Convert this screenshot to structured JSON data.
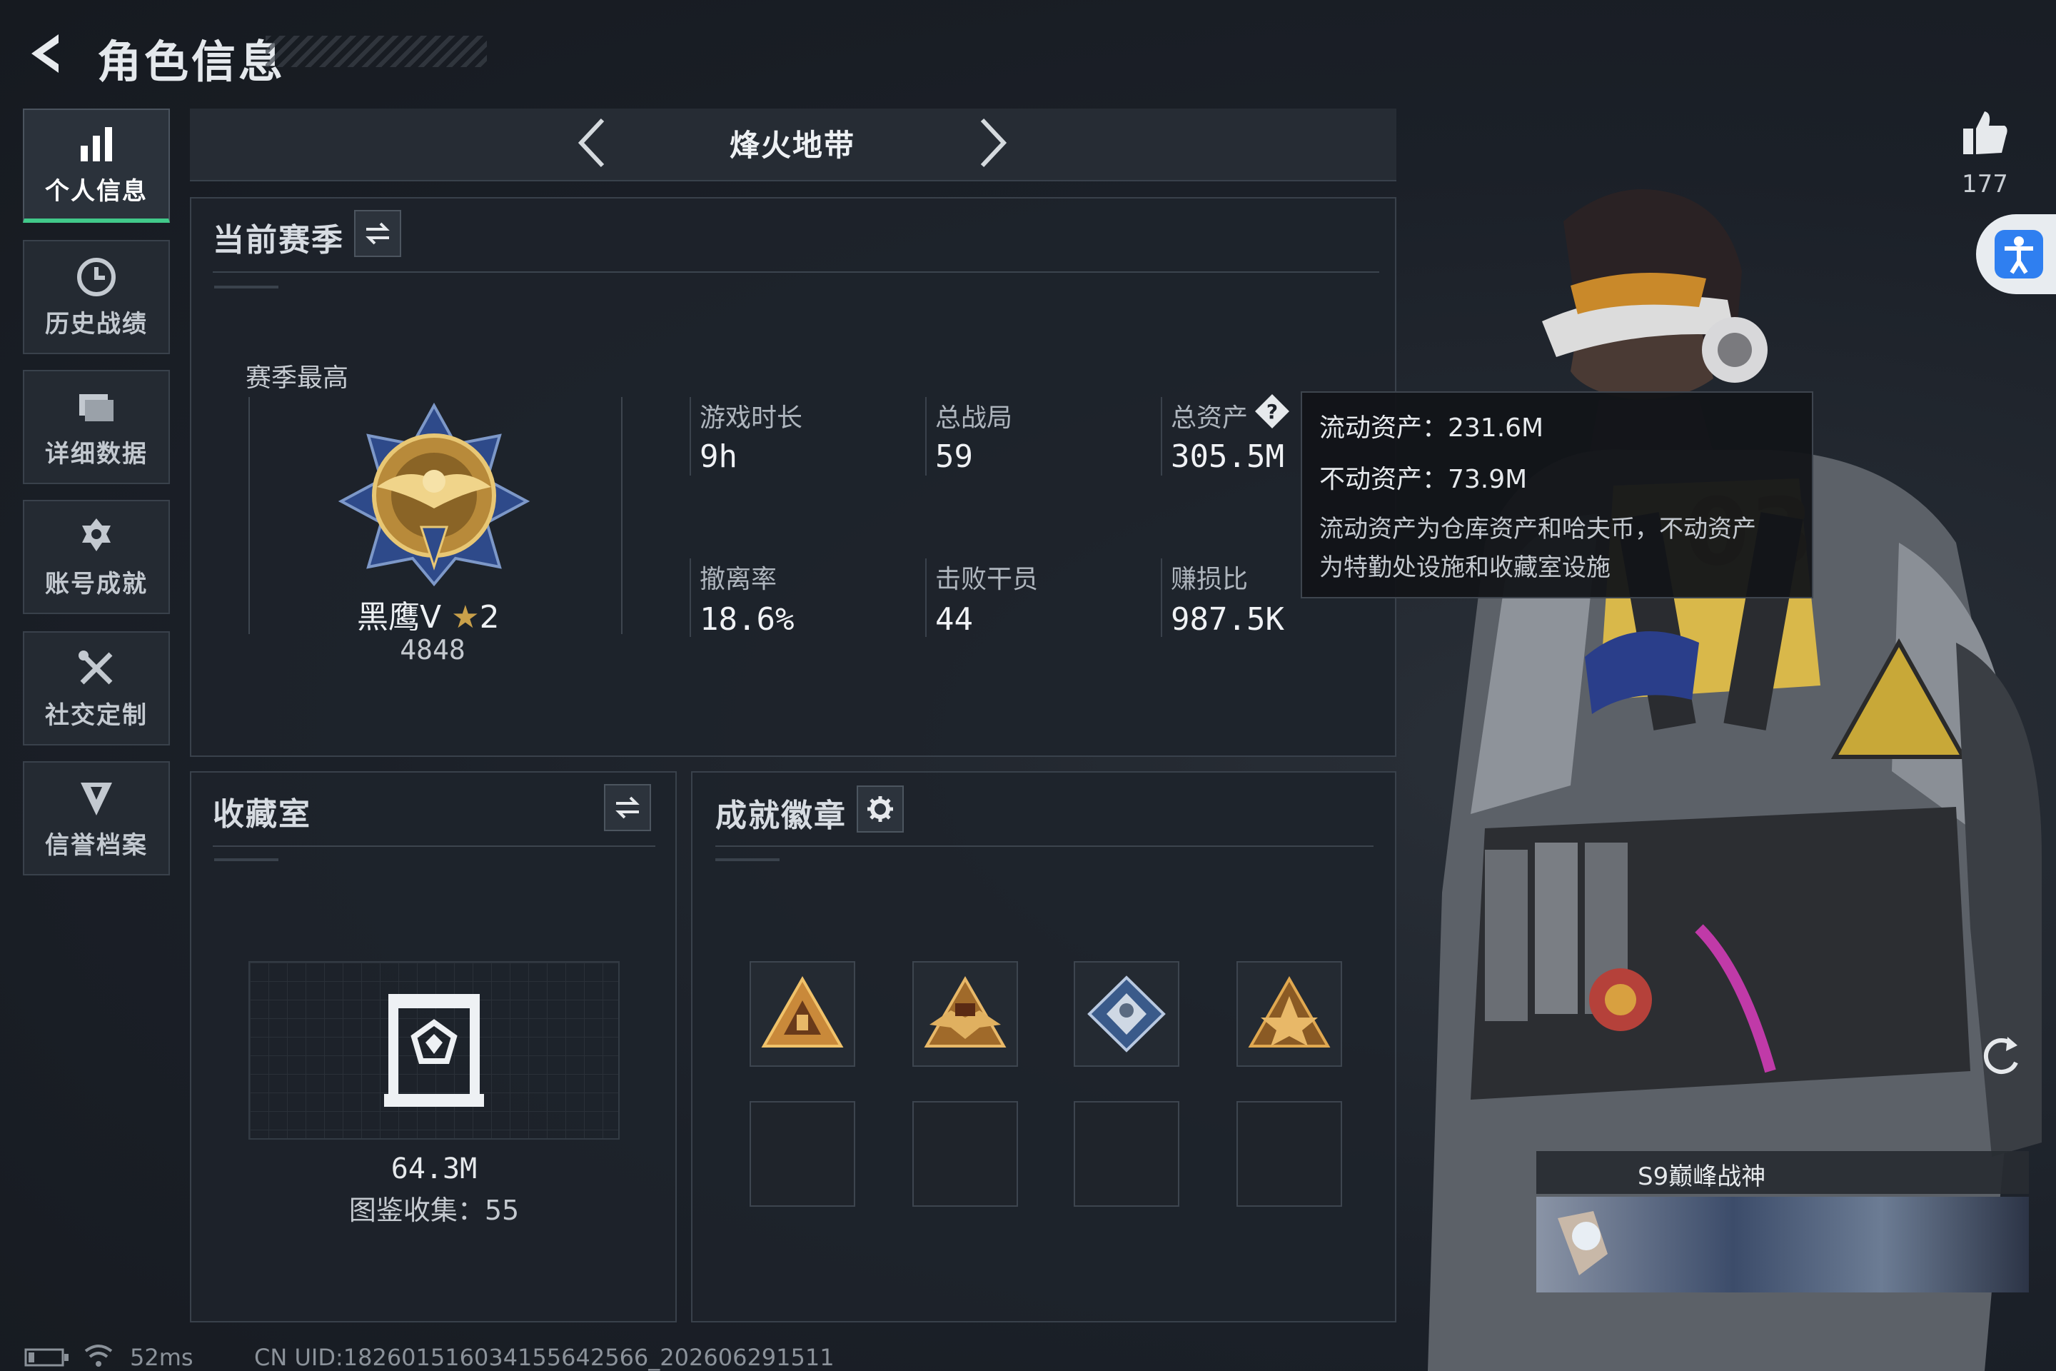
{
  "header": {
    "title": "角色信息"
  },
  "sidebar": {
    "items": [
      {
        "label": "个人信息",
        "icon": "bar-chart-icon",
        "active": true
      },
      {
        "label": "历史战绩",
        "icon": "clock-icon"
      },
      {
        "label": "详细数据",
        "icon": "folder-icon"
      },
      {
        "label": "账号成就",
        "icon": "achievement-icon"
      },
      {
        "label": "社交定制",
        "icon": "tools-icon"
      },
      {
        "label": "信誉档案",
        "icon": "shield-icon"
      }
    ]
  },
  "mode": {
    "title": "烽火地带"
  },
  "season": {
    "title": "当前赛季",
    "best_label": "赛季最高",
    "rank_name": "黑鹰V",
    "rank_stars": "2",
    "rank_score": "4848",
    "stats": [
      {
        "label": "游戏时长",
        "value": "9h"
      },
      {
        "label": "总战局",
        "value": "59"
      },
      {
        "label": "总资产",
        "value": "305.5M"
      },
      {
        "label": "撤离率",
        "value": "18.6%"
      },
      {
        "label": "击败干员",
        "value": "44"
      },
      {
        "label": "赚损比",
        "value": "987.5K"
      }
    ]
  },
  "tooltip": {
    "liquid": "流动资产：231.6M",
    "fixed": "不动资产：73.9M",
    "desc_line1": "流动资产为仓库资产和哈夫币，不动资产",
    "desc_line2": "为特勤处设施和收藏室设施"
  },
  "collection": {
    "title": "收藏室",
    "value": "64.3M",
    "count_text": "图鉴收集：55"
  },
  "badges": {
    "title": "成就徽章",
    "slots": [
      "triangle-badge-icon",
      "s9-badge-icon",
      "diamond-badge-icon",
      "triangle-star-badge-icon",
      "",
      "",
      "",
      ""
    ]
  },
  "profile": {
    "likes": "177",
    "title_tag": "S9巅峰战神"
  },
  "status_bar": {
    "ping": "52ms",
    "uid": "CN UID:1826015160341556425​66_202606291511"
  },
  "colors": {
    "accent_green": "#41c98a",
    "accessibility_blue": "#2f7ff0",
    "gold": "#c9a04a"
  }
}
